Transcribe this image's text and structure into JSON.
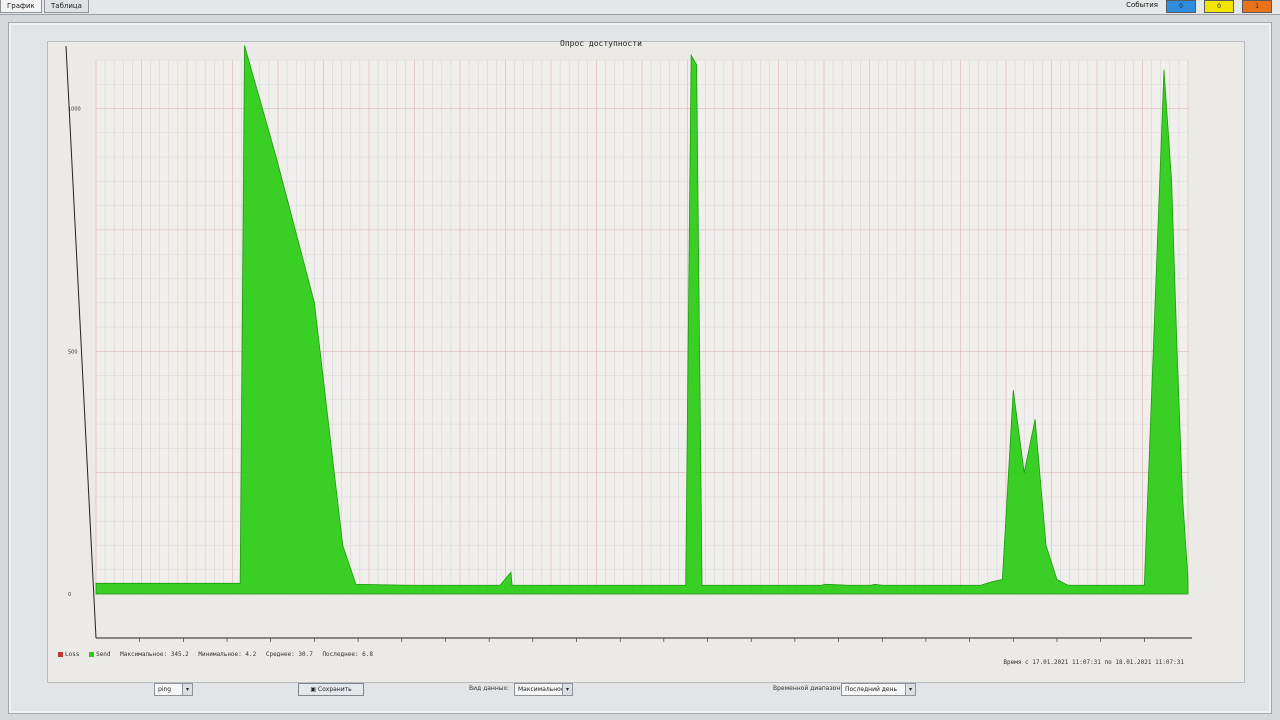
{
  "tabs": [
    {
      "label": "График",
      "active": true
    },
    {
      "label": "Таблица",
      "active": false
    }
  ],
  "events": {
    "label": "События",
    "buttons": [
      {
        "label": "0",
        "color": "#2f8de0"
      },
      {
        "label": "0",
        "color": "#f2e300"
      },
      {
        "label": "1",
        "color": "#e8731a"
      }
    ]
  },
  "chart_data": {
    "type": "area",
    "title": "Опрос доступности",
    "ylabel": "",
    "ylim": [
      0,
      1100
    ],
    "yticks": [
      0,
      500,
      1000
    ],
    "xlim": [
      0,
      1
    ],
    "xticks": [
      0.04,
      0.08,
      0.12,
      0.16,
      0.2,
      0.24,
      0.28,
      0.32,
      0.36,
      0.4,
      0.44,
      0.48,
      0.52,
      0.56,
      0.6,
      0.64,
      0.68,
      0.72,
      0.76,
      0.8,
      0.84,
      0.88,
      0.92,
      0.96
    ],
    "grid": true,
    "legend_placement": "bottom-left",
    "series": [
      {
        "name": "Loss",
        "color": "#c0392b",
        "values": []
      },
      {
        "name": "Send",
        "color": "#2ecc1a",
        "x": [
          0.0,
          0.13,
          0.132,
          0.136,
          0.165,
          0.2,
          0.226,
          0.238,
          0.29,
          0.37,
          0.38,
          0.381,
          0.52,
          0.526,
          0.54,
          0.545,
          0.55,
          0.555,
          0.56,
          0.6,
          0.664,
          0.668,
          0.69,
          0.71,
          0.713,
          0.72,
          0.8,
          0.81,
          0.82,
          0.83,
          0.84,
          0.85,
          0.86,
          0.87,
          0.88,
          0.89,
          0.9,
          0.96,
          0.978,
          0.985,
          0.99,
          0.995,
          1.0,
          1.005,
          1.012,
          1.1
        ],
        "values": [
          22,
          22,
          22,
          1130,
          900,
          600,
          100,
          20,
          18,
          18,
          45,
          18,
          18,
          18,
          18,
          1110,
          1090,
          18,
          18,
          18,
          18,
          20,
          18,
          18,
          20,
          18,
          18,
          18,
          25,
          30,
          420,
          250,
          360,
          100,
          30,
          18,
          18,
          18,
          1080,
          850,
          500,
          200,
          30,
          18,
          18,
          18
        ]
      }
    ],
    "max": "345.2",
    "min": "4.2",
    "avg": "30.7",
    "last": "6.8"
  },
  "stats": {
    "loss_label": "Loss",
    "send_label": "Send",
    "max_label": "Максимальное: 345.2",
    "min_label": "Минимальное: 4.2",
    "avg_label": "Среднее: 30.7",
    "last_label": "Последнее: 6.8",
    "range_label": "Время с 17.01.2021 11:07:31 по 18.01.2021 11:07:31"
  },
  "controls": {
    "metric_select": "ping",
    "save_button": "Сохранить",
    "data_view_label": "Вид данных:",
    "data_view_select": "Максимальное",
    "time_range_label": "Временной диапазон:",
    "time_range_select": "Последний день"
  }
}
